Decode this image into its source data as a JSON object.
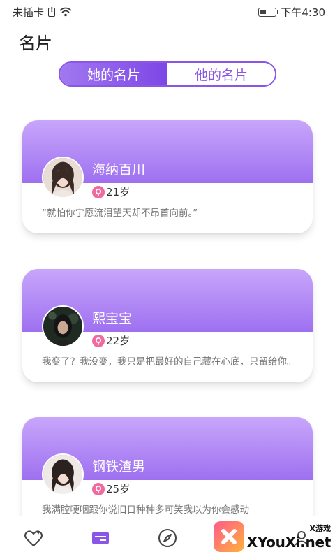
{
  "status_bar": {
    "carrier": "未插卡",
    "time": "下午4:30",
    "icons": [
      "sim-alert-icon",
      "wifi-icon",
      "battery-icon"
    ]
  },
  "page": {
    "title": "名片"
  },
  "tabs": [
    {
      "label": "她的名片",
      "active": true
    },
    {
      "label": "他的名片",
      "active": false
    }
  ],
  "cards": [
    {
      "name": "海纳百川",
      "age": "21岁",
      "quote": "“就怕你宁愿流泪望天却不昂首向前。”"
    },
    {
      "name": "熙宝宝",
      "age": "22岁",
      "quote": "我变了？我没变，我只是把最好的自己藏在心底，只留给你。"
    },
    {
      "name": "钢铁渣男",
      "age": "25岁",
      "quote": "我满腔哽咽跟你说旧日种种多可笑我以为你会感动"
    }
  ],
  "bottom_nav": [
    {
      "icon": "heart-sparkle-icon",
      "active": false
    },
    {
      "icon": "card-icon",
      "active": true
    },
    {
      "icon": "compass-icon",
      "active": false
    },
    {
      "icon": "chat-icon",
      "active": false
    },
    {
      "icon": "profile-icon",
      "active": false
    }
  ],
  "watermark": {
    "small": "X游戏",
    "big": "XYouXi.net"
  },
  "colors": {
    "accent": "#8a56e8",
    "card_gradient_top": "#c8a6fb",
    "card_gradient_bottom": "#9e70f0",
    "female_badge": "#f06aa0"
  }
}
